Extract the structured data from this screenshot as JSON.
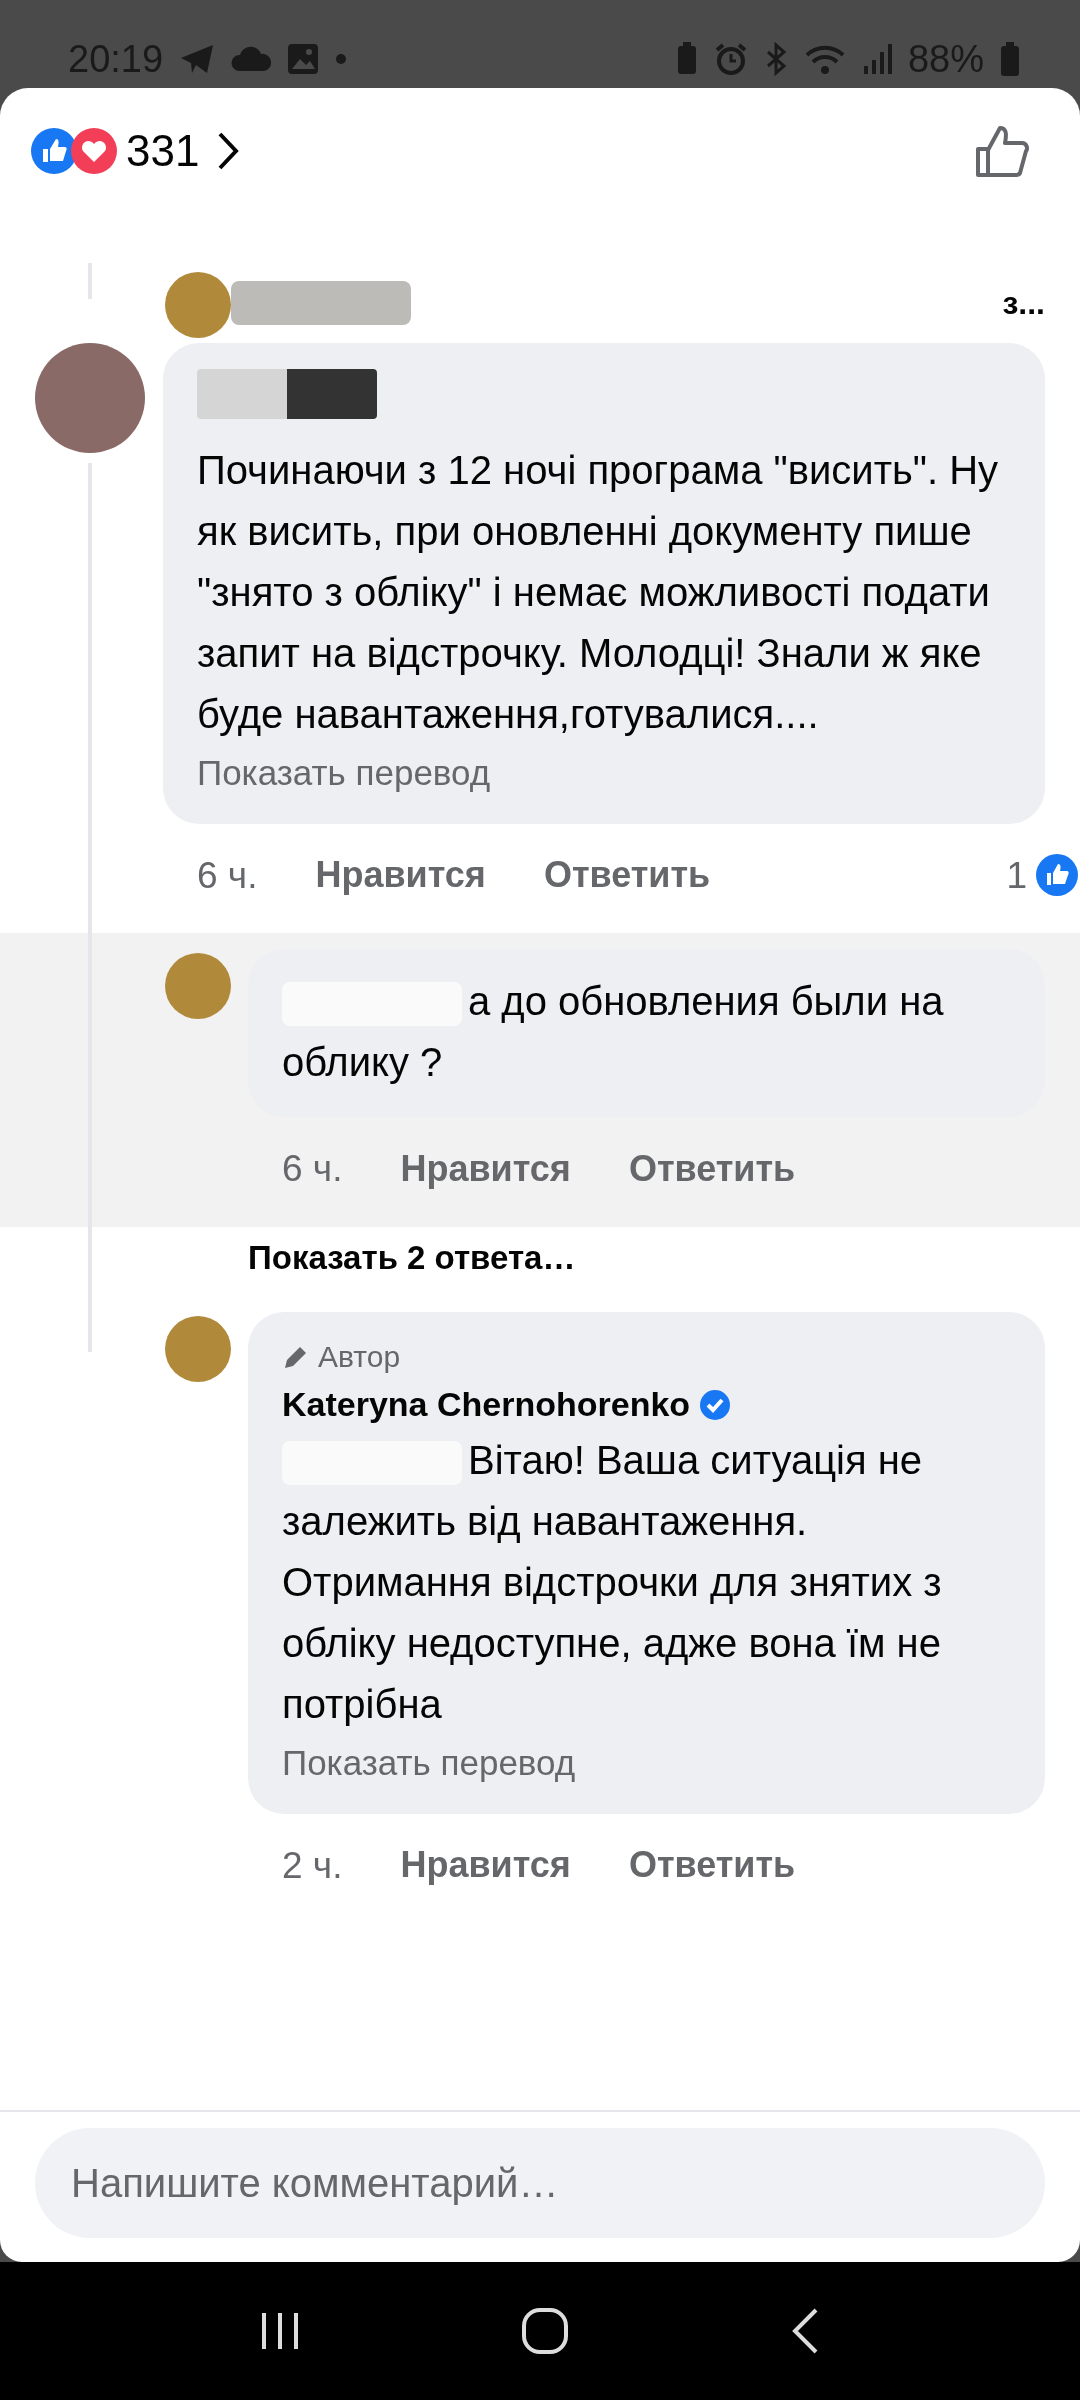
{
  "status_bar": {
    "time": "20:19",
    "battery": "88%"
  },
  "reactions": {
    "count": "331"
  },
  "partial_reply": {
    "text": "з..."
  },
  "comments": [
    {
      "kind": "comment",
      "mention_redacted": false,
      "text": "Починаючи з 12 ночі програма \"висить\". Ну як висить, при оновленні документу пише \"знято з обліку\" і немає можливості подати запит на відстрочку. Молодці! Знали ж яке буде навантаження,готувалися....",
      "translate": "Показать перевод",
      "time": "6 ч.",
      "like": "Нравится",
      "reply": "Ответить",
      "like_count": "1",
      "highlighted": false,
      "replies": [
        {
          "kind": "reply",
          "mention_redacted": true,
          "text": "а до обновления были на облику ?",
          "time": "6 ч.",
          "like": "Нравится",
          "reply": "Ответить",
          "highlighted": true
        },
        {
          "kind": "more_replies",
          "text": "Показать 2 ответа…"
        },
        {
          "kind": "reply",
          "author_badge": "Автор",
          "name": "Kateryna Chernohorenko",
          "verified": true,
          "mention_redacted": true,
          "text": "Вітаю! Ваша ситуація не залежить від навантаження. Отримання відстрочки для знятих з обліку недоступне, адже вона їм не потрібна",
          "translate": "Показать перевод",
          "time": "2 ч.",
          "like": "Нравится",
          "reply": "Ответить",
          "highlighted": false
        }
      ]
    }
  ],
  "composer": {
    "placeholder": "Напишите комментарий…"
  }
}
